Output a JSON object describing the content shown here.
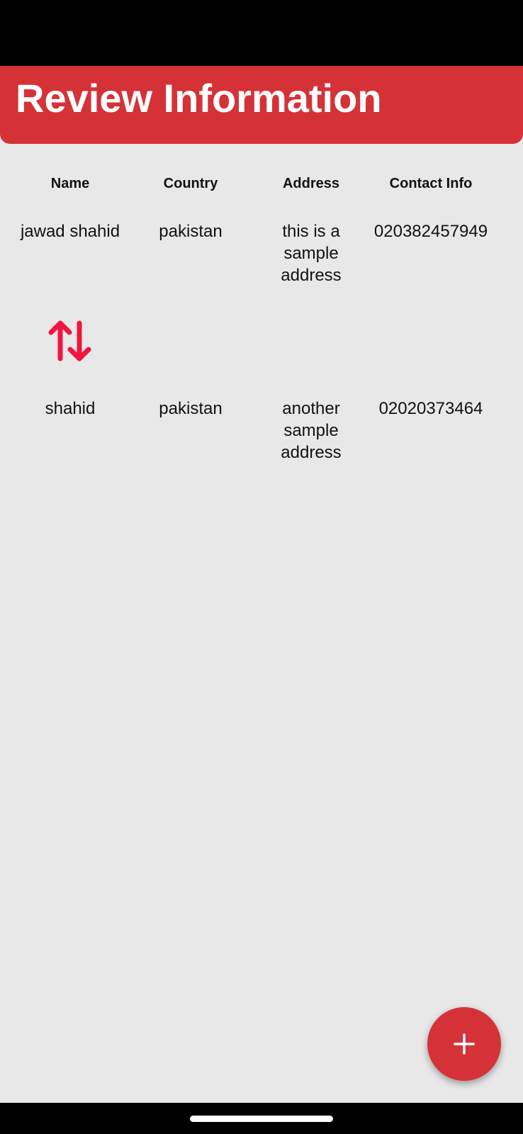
{
  "header": {
    "title": "Review Information"
  },
  "table": {
    "columns": [
      "Name",
      "Country",
      "Address",
      "Contact Info"
    ],
    "rows": [
      {
        "name": "jawad shahid",
        "country": "pakistan",
        "address": "this is a sample address",
        "contact": "020382457949"
      },
      {
        "name": "shahid",
        "country": "pakistan",
        "address": "another sample address",
        "contact": "02020373464"
      }
    ]
  },
  "icons": {
    "sort": "swap-vertical-icon",
    "fab": "plus-icon"
  },
  "colors": {
    "accent": "#d53238",
    "sort_icon": "#f0163f",
    "background": "#e8e8e8"
  }
}
